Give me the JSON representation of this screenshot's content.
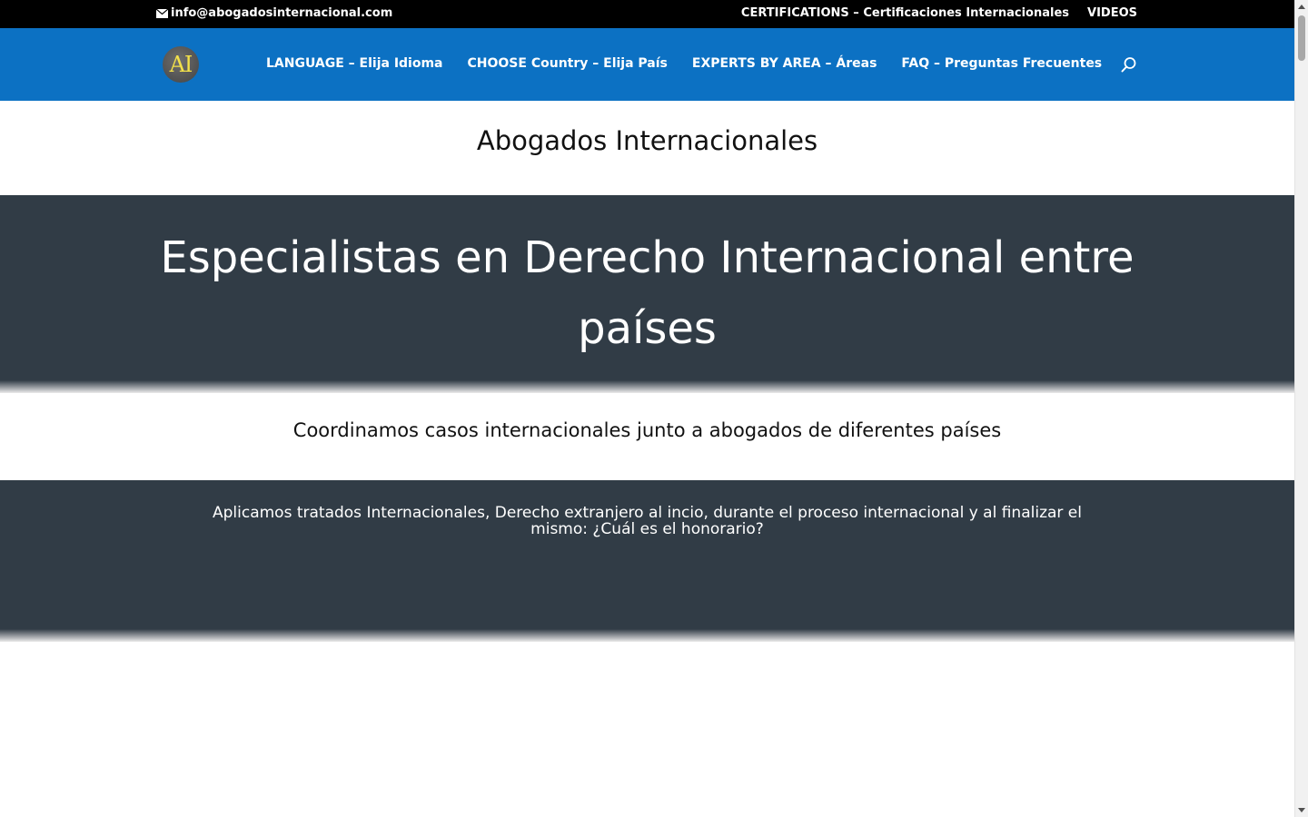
{
  "topbar": {
    "email": "info@abogadosinternacional.com",
    "links": [
      "CERTIFICATIONS – Certificaciones Internacionales",
      "VIDEOS"
    ]
  },
  "header": {
    "logo_text": "AI",
    "nav": [
      "LANGUAGE – Elija Idioma",
      "CHOOSE Country – Elija País",
      "EXPERTS BY AREA – Áreas",
      "FAQ – Preguntas Frecuentes"
    ],
    "search_icon": "search-icon"
  },
  "main": {
    "title": "Abogados Internacionales",
    "hero_heading": "Especialistas en Derecho Internacional entre países",
    "subtitle": "Coordinamos casos internacionales junto a abogados de diferentes países",
    "info_text": "Aplicamos tratados Internacionales, Derecho extranjero al incio, durante el proceso internacional y al finalizar el mismo: ¿Cuál es el honorario?"
  },
  "colors": {
    "topbar": "#000000",
    "header": "#0c71c3",
    "dark_section": "#313c46",
    "logo_text": "#f2e04a"
  }
}
